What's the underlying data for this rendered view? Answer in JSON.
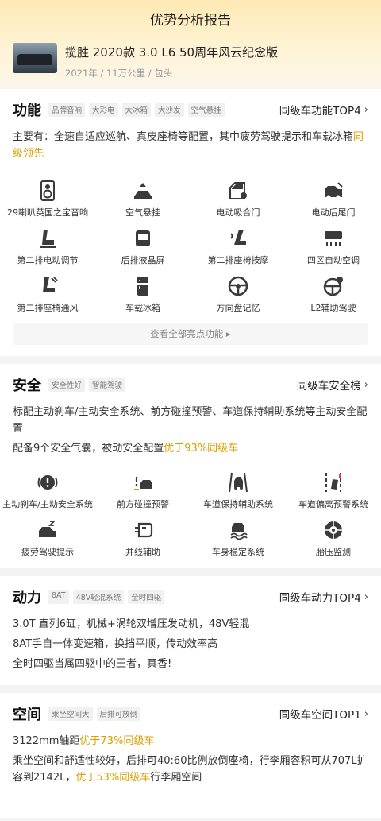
{
  "page": {
    "title": "优势分析报告"
  },
  "car": {
    "name": "揽胜 2020款 3.0 L6 50周年风云纪念版",
    "meta": "2021年 / 11万公里 / 包头"
  },
  "function": {
    "title": "功能",
    "tags": [
      "品牌音响",
      "大彩电",
      "大冰箱",
      "大沙发",
      "空气悬挂"
    ],
    "rank": "同级车功能TOP4",
    "desc_main": "主要有：全速自适应巡航、真皮座椅等配置，其中疲劳驾驶提示和车载冰箱",
    "desc_highlight": "同级领先",
    "items": [
      {
        "label": "29喇叭英国之宝音响",
        "icon": "speaker-icon"
      },
      {
        "label": "空气悬挂",
        "icon": "air-suspension-icon"
      },
      {
        "label": "电动吸合门",
        "icon": "soft-close-door-icon"
      },
      {
        "label": "电动后尾门",
        "icon": "power-tailgate-icon"
      },
      {
        "label": "第二排电动调节",
        "icon": "seat-adjust-icon"
      },
      {
        "label": "后排液晶屏",
        "icon": "rear-screen-icon"
      },
      {
        "label": "第二排座椅按摩",
        "icon": "seat-massage-icon"
      },
      {
        "label": "四区自动空调",
        "icon": "air-conditioner-icon"
      },
      {
        "label": "第二排座椅通风",
        "icon": "seat-ventilation-icon"
      },
      {
        "label": "车载冰箱",
        "icon": "fridge-icon"
      },
      {
        "label": "方向盘记忆",
        "icon": "steering-wheel-icon"
      },
      {
        "label": "L2辅助驾驶",
        "icon": "assisted-driving-icon"
      }
    ],
    "more": "查看全部亮点功能 ▸"
  },
  "safety": {
    "title": "安全",
    "tags": [
      "安全性好",
      "智能驾驶"
    ],
    "rank": "同级车安全榜",
    "desc1": "标配主动刹车/主动安全系统、前方碰撞预警、车道保持辅助系统等主动安全配置",
    "desc2_main": "配备9个安全气囊，被动安全配置",
    "desc2_highlight": "优于93%同级车",
    "items": [
      {
        "label": "主动刹车/主动安全系统",
        "icon": "brake-icon"
      },
      {
        "label": "前方碰撞预警",
        "icon": "collision-warning-icon"
      },
      {
        "label": "车道保持辅助系统",
        "icon": "lane-keep-icon"
      },
      {
        "label": "车道偏离预警系统",
        "icon": "lane-departure-icon"
      },
      {
        "label": "疲劳驾驶提示",
        "icon": "fatigue-icon"
      },
      {
        "label": "并线辅助",
        "icon": "blind-spot-icon"
      },
      {
        "label": "车身稳定系统",
        "icon": "stability-icon"
      },
      {
        "label": "胎压监测",
        "icon": "tire-pressure-icon"
      }
    ]
  },
  "power": {
    "title": "动力",
    "tags": [
      "8AT",
      "48V轻混系统",
      "全时四驱"
    ],
    "rank": "同级车动力TOP4",
    "lines": [
      "3.0T 直列6缸，机械+涡轮双增压发动机，48V轻混",
      "8AT手自一体变速箱，换挡平顺，传动效率高",
      "全时四驱当属四驱中的王者，真香!"
    ]
  },
  "space": {
    "title": "空间",
    "tags": [
      "乘坐空间大",
      "后排可放倒"
    ],
    "rank": "同级车空间TOP1",
    "line1_main": "3122mm轴距",
    "line1_highlight": "优于73%同级车",
    "line2_main": "乘坐空间和舒适性较好，后排可40:60比例放倒座椅，行李厢容积可从707L扩容到2142L，",
    "line2_highlight": "优于53%同级车",
    "line2_tail": "行李厢空间"
  },
  "colors": {
    "accent": "#d9a000",
    "icon": "#3a3a3a"
  }
}
